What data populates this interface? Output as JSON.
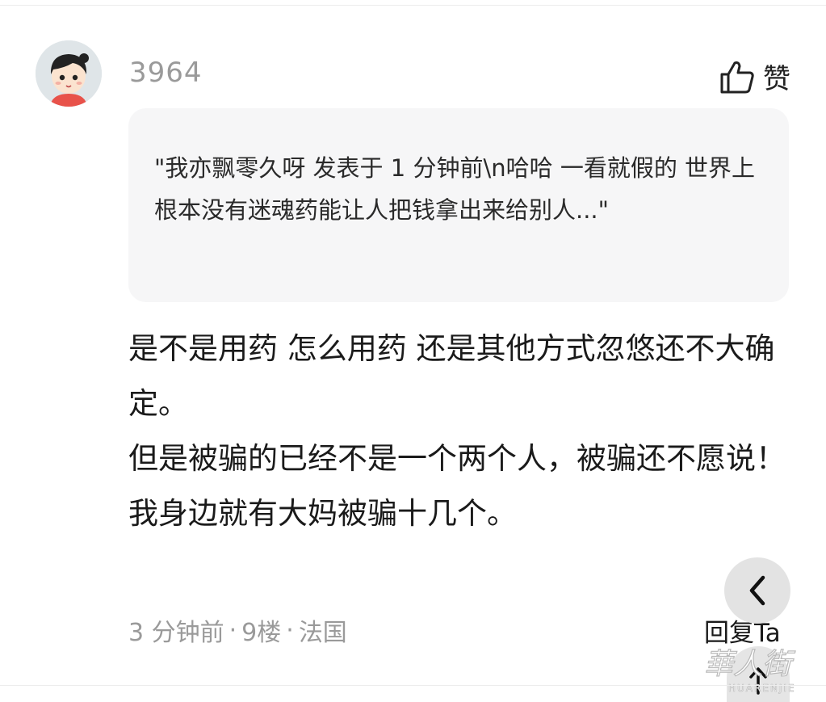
{
  "comment": {
    "username": "3964",
    "like_label": "赞",
    "quote_text": "\"我亦飘零久呀 发表于 1 分钟前\\n哈哈 一看就假的 世界上根本没有迷魂药能让人把钱拿出来给别人...\"",
    "body_lines": [
      "是不是用药 怎么用药 还是其他方式忽悠还不大确定。",
      "但是被骗的已经不是一个两个人，被骗还不愿说！",
      "我身边就有大妈被骗十几个。"
    ],
    "meta": {
      "time": "3 分钟前",
      "floor": "9楼",
      "location": "法国",
      "separator": "·"
    },
    "reply_label": "回复Ta"
  },
  "icons": {
    "avatar": "cartoon-avatar",
    "like": "thumbs-up-icon",
    "back": "chevron-left-icon",
    "scroll_top": "arrow-up-icon",
    "watermark": "huarenjie-logo"
  },
  "watermark": {
    "text_cn": "華人街",
    "text_en": "HUARENJIE"
  }
}
